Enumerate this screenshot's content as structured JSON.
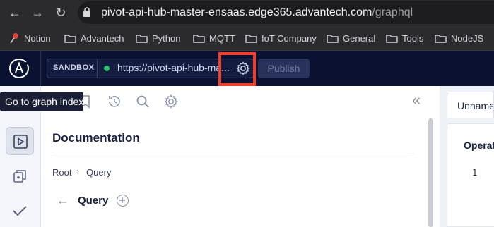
{
  "browser": {
    "url_host": "pivot-api-hub-master-ensaas.edge365.advantech.com",
    "url_path": "/graphql",
    "bookmarks": [
      {
        "label": "Notion",
        "icon": "pin-icon"
      },
      {
        "label": "Advantech",
        "icon": "folder-icon"
      },
      {
        "label": "Python",
        "icon": "folder-icon"
      },
      {
        "label": "MQTT",
        "icon": "folder-icon"
      },
      {
        "label": "IoT Company",
        "icon": "folder-icon"
      },
      {
        "label": "General",
        "icon": "folder-icon"
      },
      {
        "label": "Tools",
        "icon": "folder-icon"
      },
      {
        "label": "NodeJS",
        "icon": "folder-icon"
      }
    ]
  },
  "header": {
    "sandbox_label": "SANDBOX",
    "endpoint": "https://pivot-api-hub-ma...",
    "publish_label": "Publish",
    "status_color": "#25c36b",
    "highlight_color": "#ee3e2c"
  },
  "tooltip": {
    "text": "Go to graph index"
  },
  "docs": {
    "title": "Documentation",
    "breadcrumb_root": "Root",
    "breadcrumb_current": "Query",
    "section_title": "Query"
  },
  "operation": {
    "tab_label": "Unnamed",
    "label": "Operation",
    "line_number": "1"
  }
}
